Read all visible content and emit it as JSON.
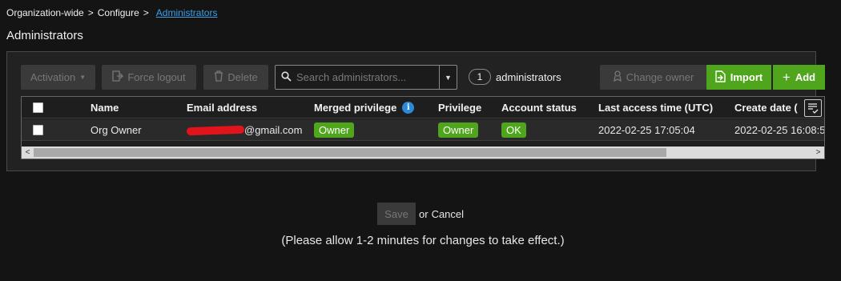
{
  "breadcrumb": {
    "items": [
      "Organization-wide",
      "Configure"
    ],
    "separator": ">",
    "current": "Administrators"
  },
  "page_title": "Administrators",
  "toolbar": {
    "activation_label": "Activation",
    "force_logout_label": "Force logout",
    "delete_label": "Delete",
    "search_placeholder": "Search administrators...",
    "count_value": "1",
    "count_label": "administrators",
    "change_owner_label": "Change owner",
    "import_label": "Import",
    "add_label": "Add"
  },
  "table": {
    "columns": [
      "Name",
      "Email address",
      "Merged privilege",
      "Privilege",
      "Account status",
      "Last access time (UTC)",
      "Create date ("
    ],
    "rows": [
      {
        "name": "Org Owner",
        "email": "@gmail.com",
        "merged_privilege": "Owner",
        "privilege": "Owner",
        "account_status": "OK",
        "last_access": "2022-02-25 17:05:04",
        "create_date": "2022-02-25 16:08:5"
      }
    ]
  },
  "footer": {
    "save_label": "Save",
    "or_cancel_prefix": "or",
    "cancel_label": "Cancel",
    "note": "(Please allow 1-2 minutes for changes to take effect.)"
  },
  "colors": {
    "accent_green": "#4fa51c",
    "link_blue": "#3aa0e8",
    "info_blue": "#2a8ad8",
    "background": "#141414"
  }
}
